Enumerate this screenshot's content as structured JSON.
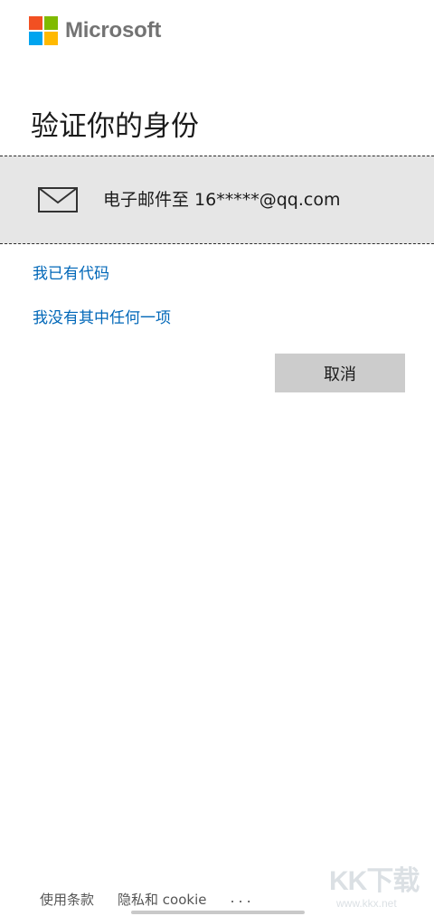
{
  "brand": {
    "name": "Microsoft",
    "colors": [
      "#f25022",
      "#7fba00",
      "#00a4ef",
      "#ffb900"
    ]
  },
  "page": {
    "title": "验证你的身份"
  },
  "verification_option": {
    "icon": "mail-icon",
    "label": "电子邮件至 16*****@qq.com"
  },
  "links": {
    "have_code": "我已有代码",
    "none_of_these": "我没有其中任何一项"
  },
  "buttons": {
    "cancel": "取消"
  },
  "footer": {
    "terms": "使用条款",
    "privacy": "隐私和 cookie",
    "more": "..."
  },
  "watermark": {
    "main": "KK下载",
    "url": "www.kkx.net"
  },
  "colors": {
    "link": "#0067b8",
    "tile_bg": "#e6e6e6",
    "button_bg": "#cccccc"
  }
}
